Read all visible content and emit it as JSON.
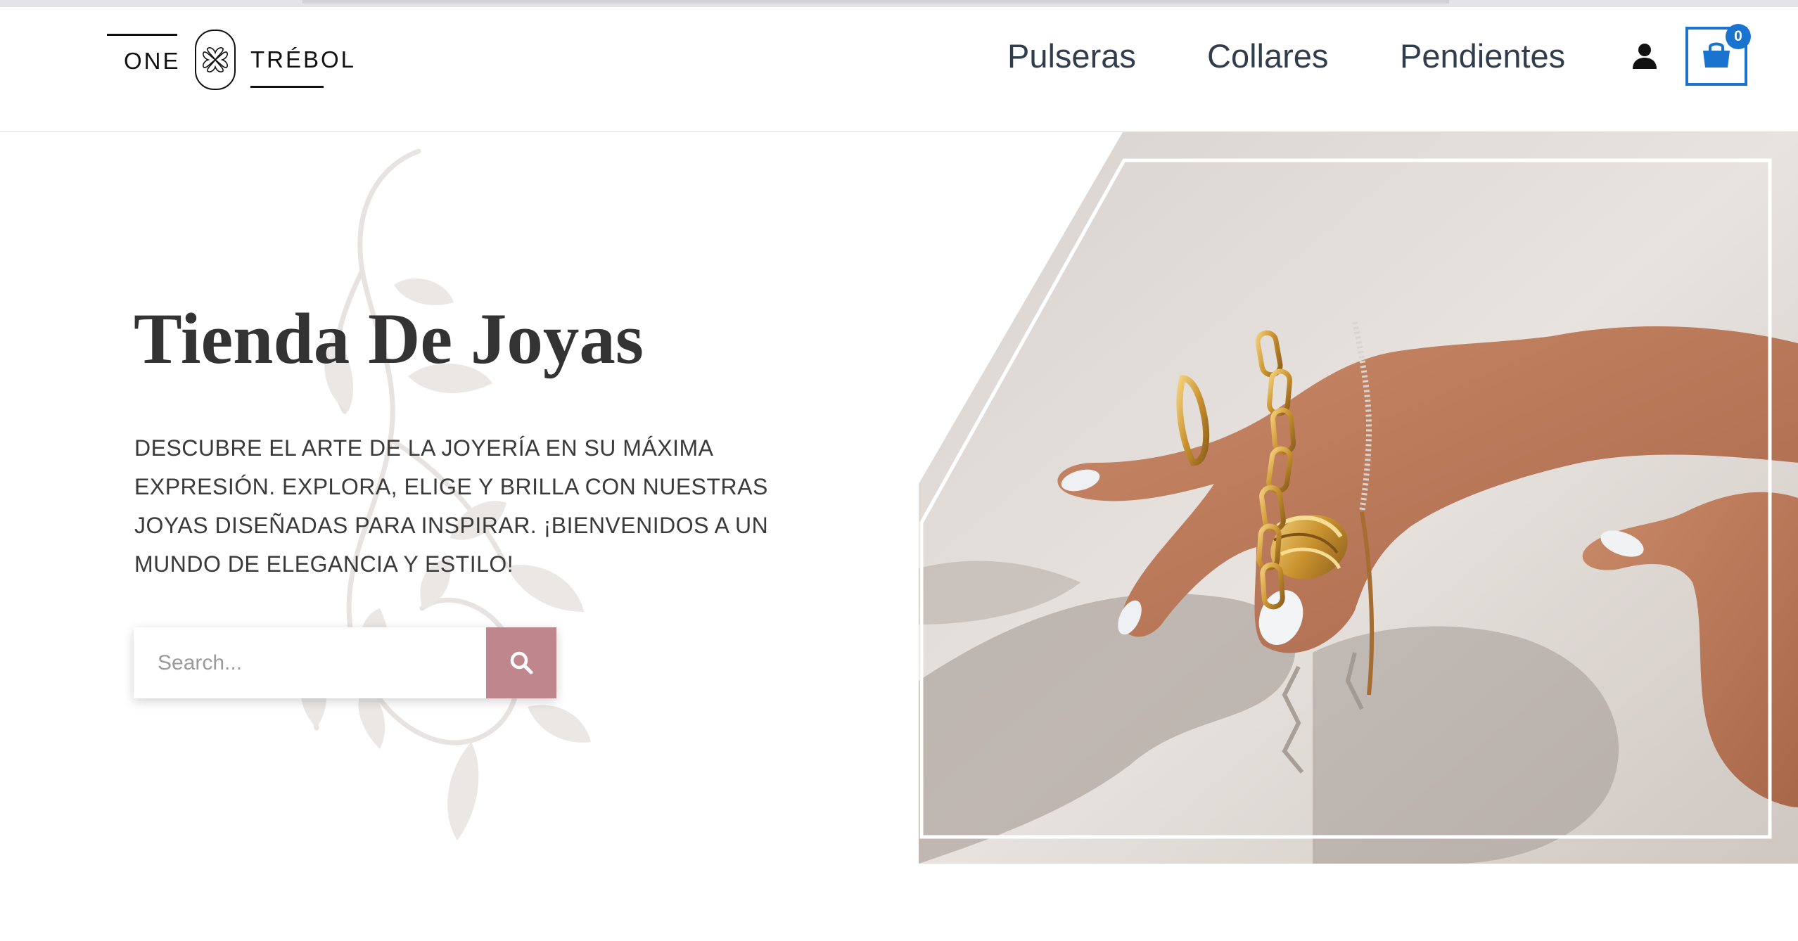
{
  "brand": {
    "name_left": "ONE",
    "name_right": "TRÉBOL"
  },
  "nav": {
    "items": [
      {
        "label": "Pulseras"
      },
      {
        "label": "Collares"
      },
      {
        "label": "Pendientes"
      }
    ]
  },
  "cart": {
    "count": "0"
  },
  "hero": {
    "title": "Tienda De Joyas",
    "description": "DESCUBRE EL ARTE DE LA JOYERÍA EN SU MÁXIMA EXPRESIÓN. EXPLORA, ELIGE Y BRILLA CON NUESTRAS JOYAS DISEÑADAS PARA INSPIRAR. ¡BIENVENIDOS A UN MUNDO DE ELEGANCIA Y ESTILO!"
  },
  "search": {
    "placeholder": "Search..."
  },
  "colors": {
    "accent": "#c0868d",
    "cart_blue": "#1a73cf",
    "nav_text": "#2f3d4c",
    "title_text": "#333333"
  },
  "icons": {
    "logo": "clover-icon",
    "user": "user-icon",
    "cart": "shopping-bag-icon",
    "search": "search-icon"
  }
}
